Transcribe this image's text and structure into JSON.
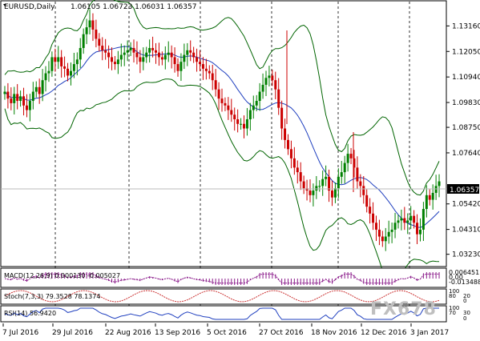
{
  "header": {
    "symbol_tf": "EURUSD,Daily",
    "ohlc": "1.06105 1.06723 1.06031 1.06357"
  },
  "price_axis": {
    "labels": [
      "1.13160",
      "1.12050",
      "1.10940",
      "1.09830",
      "1.08750",
      "1.07640",
      "1.05420",
      "1.04310",
      "1.03230"
    ],
    "current": "1.06357"
  },
  "indicators": {
    "macd": {
      "label": "MACD(12,26,9) 0.000130 -0.005027",
      "scale_top": "0.006451",
      "scale_zero": "0.00",
      "scale_bottom": "-0.013488"
    },
    "stoch": {
      "label": "Stoch(7,3,3) 79.3528 78.1374",
      "scale_top": "100",
      "scale_mid": "80",
      "scale_low": "20",
      "scale_bottom": "0"
    },
    "rsi": {
      "label": "RSI(14) 56.9420",
      "scale_top": "100",
      "scale_mid": "70",
      "scale_low": "30",
      "scale_bottom": "0"
    }
  },
  "time_axis": {
    "labels": [
      "7 Jul 2016",
      "29 Jul 2016",
      "22 Aug 2016",
      "13 Sep 2016",
      "5 Oct 2016",
      "27 Oct 2016",
      "18 Nov 2016",
      "12 Dec 2016",
      "3 Jan 2017"
    ]
  },
  "watermark": "FX678",
  "colors": {
    "bull": "#008000",
    "bear": "#cc0000",
    "band": "#006400",
    "mid": "#1f3fbf",
    "macd": "#8a1a8a"
  },
  "chart_data": {
    "type": "candlestick",
    "x_labels": [
      "7 Jul 2016",
      "29 Jul 2016",
      "22 Aug 2016",
      "13 Sep 2016",
      "5 Oct 2016",
      "27 Oct 2016",
      "18 Nov 2016",
      "12 Dec 2016",
      "3 Jan 2017"
    ],
    "ylim": [
      1.028,
      1.138
    ],
    "close_path": [
      1.103,
      1.1,
      1.098,
      1.102,
      1.099,
      1.101,
      1.097,
      1.095,
      1.099,
      1.103,
      1.105,
      1.102,
      1.108,
      1.111,
      1.112,
      1.118,
      1.116,
      1.118,
      1.114,
      1.113,
      1.11,
      1.112,
      1.115,
      1.117,
      1.122,
      1.128,
      1.131,
      1.134,
      1.13,
      1.126,
      1.123,
      1.121,
      1.12,
      1.118,
      1.116,
      1.115,
      1.117,
      1.119,
      1.12,
      1.121,
      1.122,
      1.12,
      1.118,
      1.116,
      1.118,
      1.12,
      1.122,
      1.121,
      1.12,
      1.118,
      1.117,
      1.119,
      1.12,
      1.118,
      1.115,
      1.112,
      1.116,
      1.119,
      1.121,
      1.12,
      1.118,
      1.116,
      1.115,
      1.113,
      1.112,
      1.111,
      1.108,
      1.104,
      1.1,
      1.098,
      1.097,
      1.095,
      1.093,
      1.091,
      1.089,
      1.089,
      1.087,
      1.091,
      1.095,
      1.097,
      1.099,
      1.103,
      1.106,
      1.109,
      1.11,
      1.108,
      1.104,
      1.096,
      1.087,
      1.082,
      1.078,
      1.074,
      1.07,
      1.068,
      1.064,
      1.061,
      1.06,
      1.058,
      1.06,
      1.062,
      1.062,
      1.065,
      1.066,
      1.06,
      1.057,
      1.061,
      1.066,
      1.068,
      1.072,
      1.076,
      1.074,
      1.07,
      1.064,
      1.062,
      1.058,
      1.053,
      1.05,
      1.046,
      1.043,
      1.04,
      1.038,
      1.04,
      1.042,
      1.043,
      1.046,
      1.047,
      1.048,
      1.046,
      1.047,
      1.049,
      1.046,
      1.041,
      1.043,
      1.052,
      1.058,
      1.056,
      1.059,
      1.062,
      1.064
    ]
  }
}
